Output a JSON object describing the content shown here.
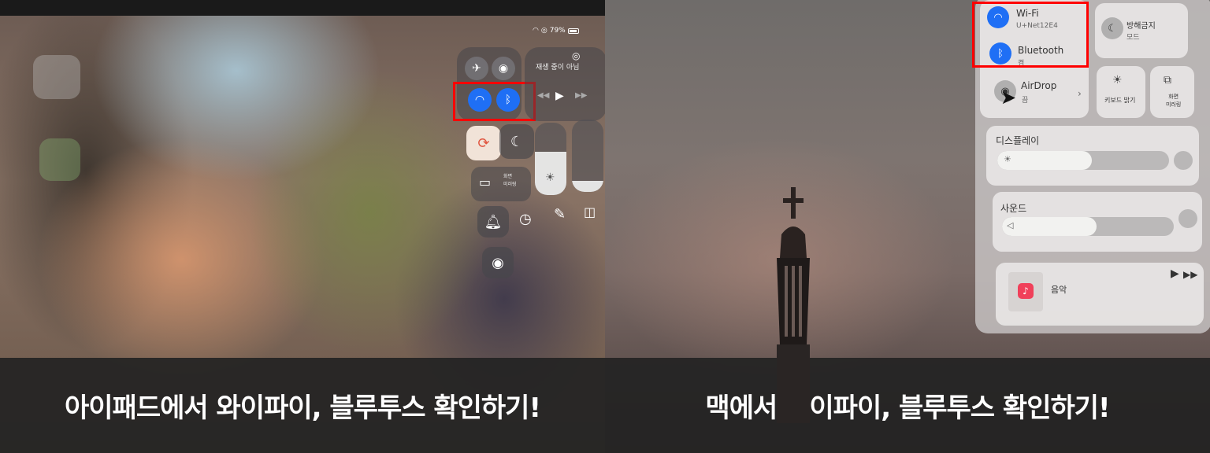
{
  "ipad": {
    "status": {
      "battery": "79%"
    },
    "now_playing": "재생 중이 아님",
    "screen_mirroring": [
      "화면",
      "미러링"
    ],
    "icons": {
      "airplane": "airplane-icon",
      "airdrop": "airdrop-icon",
      "wifi": "wifi-icon",
      "bluetooth": "bluetooth-icon",
      "orientation_lock": "orientation-lock-icon",
      "dnd": "moon-icon",
      "bell": "bell-icon",
      "timer": "timer-icon",
      "notes": "notes-icon",
      "camera": "camera-icon",
      "record": "screen-record-icon"
    },
    "brightness_level": 0.6,
    "volume_level": 0.15,
    "caption": "아이패드에서 와이파이, 블루투스 확인하기!"
  },
  "mac": {
    "wifi": {
      "title": "Wi-Fi",
      "subtitle": "U+Net12E4"
    },
    "bluetooth": {
      "title": "Bluetooth",
      "subtitle": "켬"
    },
    "airdrop": {
      "title": "AirDrop",
      "subtitle": "끔"
    },
    "dnd": {
      "title": "방해금지",
      "subtitle": "모드"
    },
    "keyboard_brightness": "키보드 밝기",
    "screen_mirroring": [
      "화면",
      "미러링"
    ],
    "display": {
      "title": "디스플레이",
      "level": 0.55
    },
    "sound": {
      "title": "사운드",
      "level": 0.55
    },
    "music": {
      "title": "음악"
    },
    "caption": "맥에서 와이파이, 블루투스 확인하기!",
    "accent_color": "#1f6ff5",
    "highlight_color": "#ff0000"
  }
}
